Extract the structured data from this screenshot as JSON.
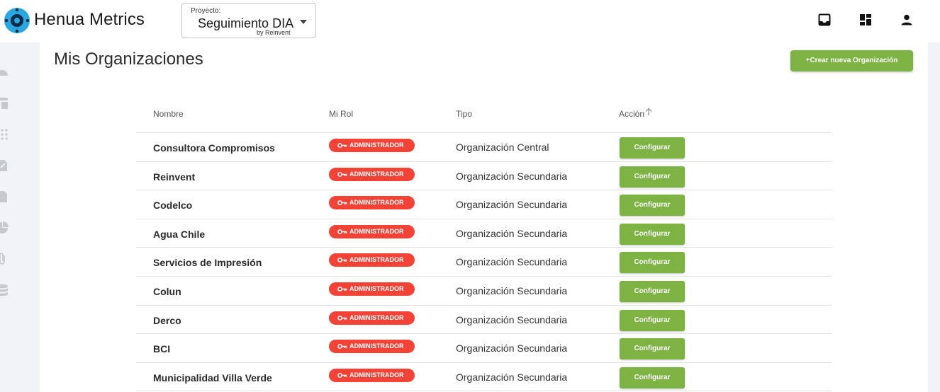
{
  "app": {
    "title": "Henua Metrics",
    "accent": "#7cb342",
    "danger": "#f44336"
  },
  "project": {
    "label": "Proyecto:",
    "name": "Seguimiento DIA",
    "subtitle": "by Reinvent"
  },
  "topbar_icons": [
    "inbox-icon",
    "dashboard-icon",
    "user-icon"
  ],
  "sidebar_icons": [
    "speed-icon",
    "table-icon",
    "grid-dots-icon",
    "edit-document-icon",
    "document-icon",
    "pie-chart-icon",
    "attachment-icon",
    "database-icon"
  ],
  "page": {
    "title": "Mis Organizaciones",
    "create_label": "+Crear nueva Organización"
  },
  "table": {
    "columns": [
      "Nombre",
      "Mi Rol",
      "Tipo",
      "Acción"
    ],
    "action_label": "Configurar",
    "rows": [
      {
        "name": "Consultora Compromisos",
        "role": "ADMINISTRADOR",
        "type": "Organización Central"
      },
      {
        "name": "Reinvent",
        "role": "ADMINISTRADOR",
        "type": "Organización Secundaria"
      },
      {
        "name": "Codelco",
        "role": "ADMINISTRADOR",
        "type": "Organización Secundaria"
      },
      {
        "name": "Agua Chile",
        "role": "ADMINISTRADOR",
        "type": "Organización Secundaria"
      },
      {
        "name": "Servicios de Impresión",
        "role": "ADMINISTRADOR",
        "type": "Organización Secundaria"
      },
      {
        "name": "Colun",
        "role": "ADMINISTRADOR",
        "type": "Organización Secundaria"
      },
      {
        "name": "Derco",
        "role": "ADMINISTRADOR",
        "type": "Organización Secundaria"
      },
      {
        "name": "BCI",
        "role": "ADMINISTRADOR",
        "type": "Organización Secundaria"
      },
      {
        "name": "Municipalidad Villa Verde",
        "role": "ADMINISTRADOR",
        "type": "Organización Secundaria"
      }
    ]
  }
}
